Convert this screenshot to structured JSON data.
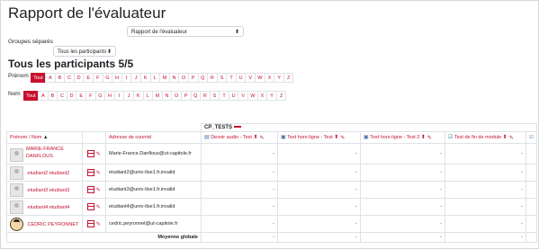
{
  "header": {
    "title": "Rapport de l'évaluateur"
  },
  "report_select": {
    "value": "Rapport de l'évaluateur"
  },
  "groups": {
    "label": "Groupes séparés",
    "value": "Tous les participants"
  },
  "participants": {
    "title": "Tous les participants 5/5"
  },
  "filters": {
    "first_name_label": "Prénom",
    "last_name_label": "Nom",
    "all_label": "Tout",
    "letters": [
      "A",
      "B",
      "C",
      "D",
      "E",
      "F",
      "G",
      "H",
      "I",
      "J",
      "K",
      "L",
      "M",
      "N",
      "O",
      "P",
      "Q",
      "R",
      "S",
      "T",
      "U",
      "V",
      "W",
      "X",
      "Y",
      "Z"
    ]
  },
  "table": {
    "category": "CP_TESTS",
    "headers": {
      "name": "Prénom / Nom",
      "name_sort": "▲",
      "email": "Adresse de courriel",
      "col1": "Devoir audio - Test",
      "col2": "Test hors-ligne - Test",
      "col3": "Test hors-ligne - Test 2",
      "col4": "Test de fin de module"
    },
    "rows": [
      {
        "name": "MARIE-FRANCE DANFLOUS",
        "email": "Marie-France.Danflous@ut-capitole.fr",
        "g1": "-",
        "g2": "-",
        "g3": "-",
        "g4": "-"
      },
      {
        "name": "etudiant2 etudiant2",
        "email": "etudiant2@univ-tlse1.fr.invalid",
        "g1": "-",
        "g2": "-",
        "g3": "-",
        "g4": "-"
      },
      {
        "name": "etudiant3 etudiant3",
        "email": "etudiant3@univ-tlse1.fr.invalid",
        "g1": "-",
        "g2": "-",
        "g3": "-",
        "g4": "-"
      },
      {
        "name": "etudiant4 etudiant4",
        "email": "etudiant4@univ-tlse1.fr.invalid",
        "g1": "-",
        "g2": "-",
        "g3": "-",
        "g4": "-"
      },
      {
        "name": "CEDRIC PEYRONNET",
        "email": "cedric.peyronnet@ut-capitole.fr",
        "g1": "-",
        "g2": "-",
        "g3": "-",
        "g4": "-"
      }
    ],
    "footer": {
      "label": "Moyenne globale",
      "g1": "-",
      "g2": "-",
      "g3": "-",
      "g4": "-"
    }
  }
}
